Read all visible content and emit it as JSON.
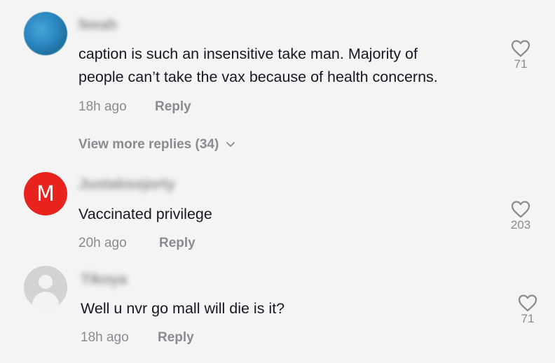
{
  "comments": [
    {
      "username": "feeah",
      "text_lines": [
        "caption is such an insensitive take man. Majority of",
        "people can’t take the vax because of health concerns."
      ],
      "time": "18h ago",
      "reply_label": "Reply",
      "likes": "71",
      "view_more": "View more replies (34)"
    },
    {
      "avatar_letter": "M",
      "username": "Justabsojorty",
      "text_lines": [
        "Vaccinated privilege"
      ],
      "time": "20h ago",
      "reply_label": "Reply",
      "likes": "203"
    },
    {
      "username": "Tikoya",
      "text_lines": [
        "Well u nvr go mall will die is it?"
      ],
      "time": "18h ago",
      "reply_label": "Reply",
      "likes": "71"
    }
  ],
  "colors": {
    "avatar_red": "#e8231d",
    "secondary_text": "#8a8b91",
    "primary_text": "#161823"
  },
  "icons": {
    "like": "heart-outline-icon",
    "expand": "chevron-down-icon"
  }
}
